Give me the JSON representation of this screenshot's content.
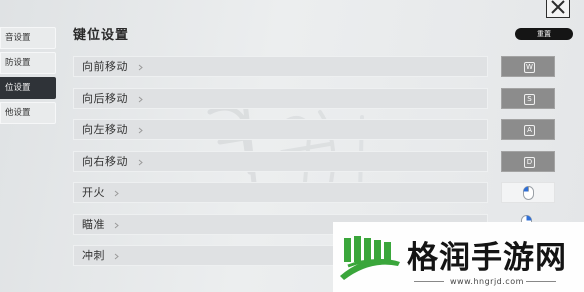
{
  "header": {
    "title": "键位设置",
    "reset_label": "重置"
  },
  "sidebar": {
    "items": [
      {
        "label": "音设置",
        "active": false
      },
      {
        "label": "防设置",
        "active": false
      },
      {
        "label": "位设置",
        "active": true
      },
      {
        "label": "他设置",
        "active": false
      }
    ]
  },
  "keybinds": [
    {
      "action": "向前移动",
      "key": "W",
      "key_icon": "keycap"
    },
    {
      "action": "向后移动",
      "key": "S",
      "key_icon": "keycap"
    },
    {
      "action": "向左移动",
      "key": "A",
      "key_icon": "keycap"
    },
    {
      "action": "向右移动",
      "key": "D",
      "key_icon": "keycap"
    },
    {
      "action": "开火",
      "key": "",
      "key_icon": "mouse-left-icon"
    },
    {
      "action": "瞄准",
      "key": "",
      "key_icon": "mouse-right-icon"
    },
    {
      "action": "冲刺",
      "key": "",
      "key_icon": ""
    }
  ],
  "watermark": {
    "text": "格润手游网",
    "url": "www.hngrjd.com"
  },
  "colors": {
    "key_bg": "#8c8c8c",
    "active_tab": "#2f3338",
    "mouse_accent": "#2f6fd6",
    "logo_green": "#3aa63b"
  }
}
